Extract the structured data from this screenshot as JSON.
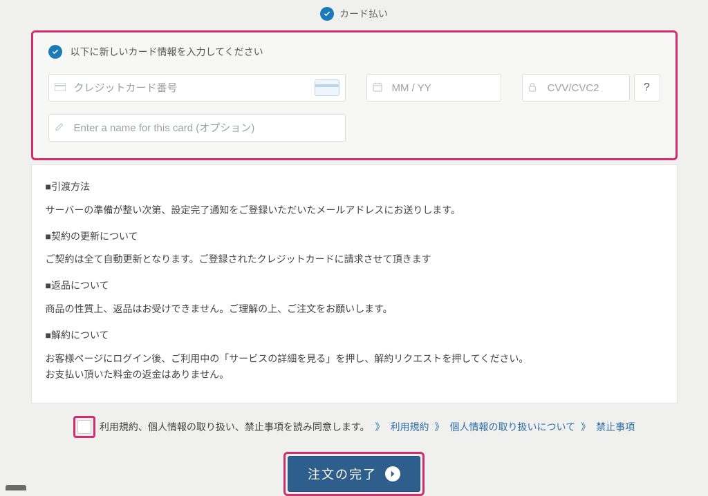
{
  "topOption": {
    "label": "カード払い"
  },
  "cardPanel": {
    "heading": "以下に新しいカード情報を入力してください",
    "ccPlaceholder": "クレジットカード番号",
    "expPlaceholder": "MM / YY",
    "cvvPlaceholder": "CVV/CVC2",
    "helpLabel": "?",
    "namePlaceholder": "Enter a name for this card (オプション)"
  },
  "info": {
    "h1": "■引渡方法",
    "p1": "サーバーの準備が整い次第、設定完了通知をご登録いただいたメールアドレスにお送りします。",
    "h2": "■契約の更新について",
    "p2": "ご契約は全て自動更新となります。ご登録されたクレジットカードに請求させて頂きます",
    "h3": "■返品について",
    "p3": "商品の性質上、返品はお受けできません。ご理解の上、ご注文をお願いします。",
    "h4": "■解約について",
    "p4a": "お客様ページにログイン後、ご利用中の「サービスの詳細を見る」を押し、解約リクエストを押してください。",
    "p4b": "お支払い頂いた料金の返金はありません。"
  },
  "terms": {
    "prefix": "利用規約、個人情報の取り扱い、禁止事項を読み同意します。",
    "sep": "》",
    "link1": "利用規約",
    "link2": "個人情報の取り扱いについて",
    "link3": "禁止事項"
  },
  "submit": {
    "label": "注文の完了"
  }
}
